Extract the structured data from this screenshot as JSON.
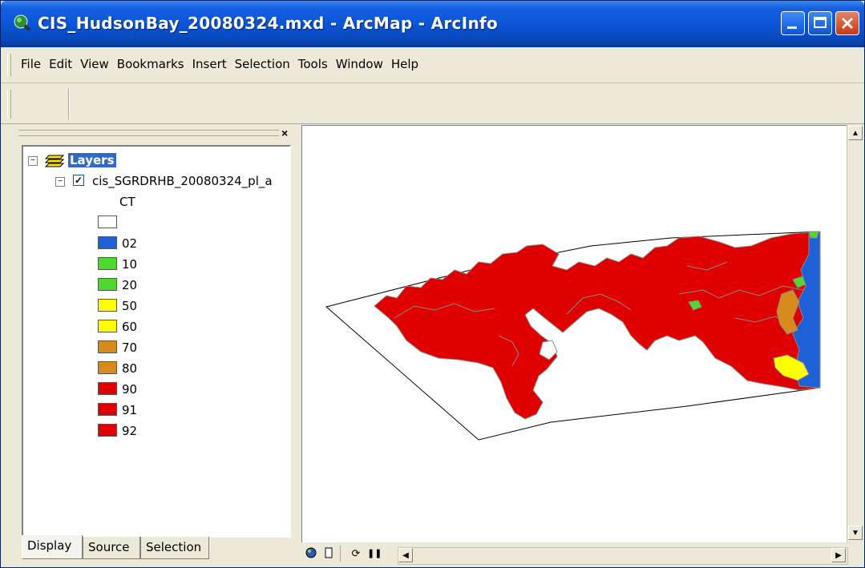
{
  "window": {
    "title": "CIS_HudsonBay_20080324.mxd - ArcMap - ArcInfo",
    "minimize_icon": "minimize-icon",
    "maximize_icon": "maximize-icon",
    "close_icon": "close-icon"
  },
  "menubar": {
    "items": [
      "File",
      "Edit",
      "View",
      "Bookmarks",
      "Insert",
      "Selection",
      "Tools",
      "Window",
      "Help"
    ]
  },
  "toc": {
    "close_label": "×",
    "root_label": "Layers",
    "layer_name": "cis_SGRDRHB_20080324_pl_a",
    "field_name": "CT",
    "legend": [
      {
        "label": "",
        "color": "#ffffff"
      },
      {
        "label": "02",
        "color": "#1f5fd8"
      },
      {
        "label": "10",
        "color": "#4fd92f"
      },
      {
        "label": "20",
        "color": "#4fd92f"
      },
      {
        "label": "50",
        "color": "#ffff00"
      },
      {
        "label": "60",
        "color": "#ffff00"
      },
      {
        "label": "70",
        "color": "#d88a1c"
      },
      {
        "label": "80",
        "color": "#d88a1c"
      },
      {
        "label": "90",
        "color": "#e00000"
      },
      {
        "label": "91",
        "color": "#e00000"
      },
      {
        "label": "92",
        "color": "#e00000"
      }
    ],
    "tabs": [
      "Display",
      "Source",
      "Selection"
    ]
  },
  "colors": {
    "ice_red": "#e00000",
    "outline_gray": "#8a8a8a",
    "accent_blue": "#316ac5"
  },
  "statusbar": {
    "icons": [
      "data-view-icon",
      "layout-view-icon",
      "refresh-icon",
      "pause-icon"
    ]
  }
}
